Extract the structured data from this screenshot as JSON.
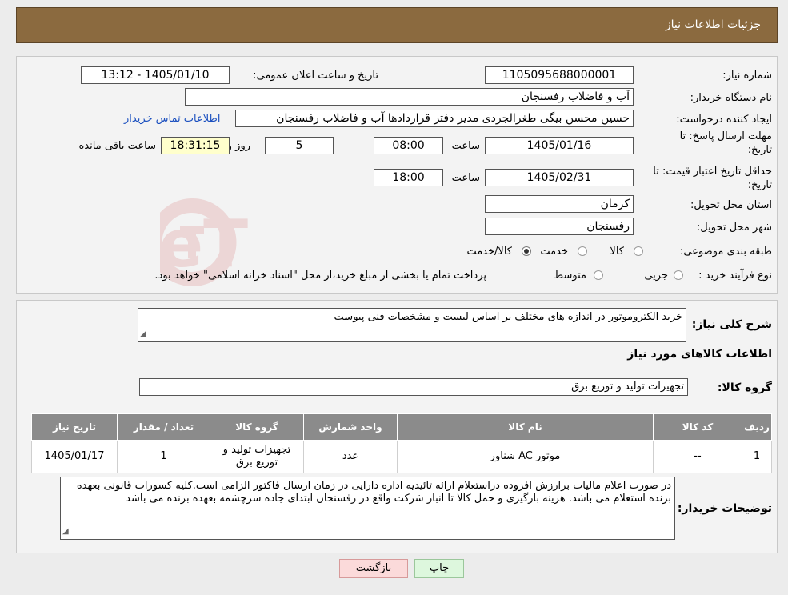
{
  "header": {
    "title": "جزئيات اطلاعات نیاز"
  },
  "form": {
    "need_number_label": "شماره نیاز:",
    "need_number": "1105095688000001",
    "announce_label": "تاریخ و ساعت اعلان عمومی:",
    "announce_value": "1405/01/10 - 13:12",
    "buyer_org_label": "نام دستگاه خریدار:",
    "buyer_org": "آب و فاضلاب رفسنجان",
    "creator_label": "ایجاد کننده درخواست:",
    "creator": "حسین محسن بیگی طغرالجردی مدیر دفتر قراردادها آب و فاضلاب رفسنجان",
    "contact_link": "اطلاعات تماس خریدار",
    "deadline_label_1": "مهلت ارسال پاسخ: تا",
    "deadline_label_2": "تاریخ:",
    "deadline_date": "1405/01/16",
    "time_label": "ساعت",
    "deadline_time": "08:00",
    "days_value": "5",
    "days_label": "روز و",
    "remaining_time": "18:31:15",
    "remaining_label": "ساعت باقی مانده",
    "validity_label_1": "حداقل تاریخ اعتبار قیمت: تا",
    "validity_label_2": "تاریخ:",
    "validity_date": "1405/02/31",
    "validity_time_label": "ساعت",
    "validity_time": "18:00",
    "province_label": "استان محل تحویل:",
    "province": "کرمان",
    "city_label": "شهر محل تحویل:",
    "city": "رفسنجان",
    "category_label": "طبقه بندی موضوعی:",
    "category_options": [
      "کالا",
      "خدمت",
      "کالا/خدمت"
    ],
    "category_selected": "کالا/خدمت",
    "process_label": "نوع فرآیند خرید :",
    "process_options": [
      "جزیی",
      "متوسط"
    ],
    "process_note": "پرداخت تمام یا بخشی از مبلغ خرید،از محل \"اسناد خزانه اسلامی\" خواهد بود."
  },
  "summary": {
    "desc_label": "شرح کلی نیاز:",
    "desc_value": "خرید الکتروموتور در اندازه های مختلف بر اساس لیست و مشخصات فنی پیوست",
    "goods_info_title": "اطلاعات کالاهای مورد نیاز",
    "goods_group_label": "گروه کالا:",
    "goods_group_value": "تجهیزات تولید و توزیع برق"
  },
  "table": {
    "headers": [
      "ردیف",
      "کد کالا",
      "نام کالا",
      "واحد شمارش",
      "گروه کالا",
      "تعداد / مقدار",
      "تاریخ نیاز"
    ],
    "rows": [
      {
        "row": "1",
        "code": "--",
        "name": "موتور AC شناور",
        "unit": "عدد",
        "group": "تجهیزات تولید و توزیع برق",
        "qty": "1",
        "date": "1405/01/17"
      }
    ]
  },
  "buyer_notes": {
    "label": "توضیحات خریدار:",
    "text": "در صورت اعلام مالیات برارزش افزوده دراستعلام ارائه تائیدیه اداره دارایی در زمان ارسال فاکتور الزامی است.کلیه کسورات قانونی بعهده برنده استعلام می باشد. هزینه بارگیری و حمل کالا تا انبار شرکت واقع در رفسنجان ابتدای جاده سرچشمه بعهده برنده می باشد"
  },
  "buttons": {
    "print": "چاپ",
    "back": "بازگشت"
  },
  "colors": {
    "header_bg": "#8b6a3f",
    "table_header_bg": "#8b8b8b",
    "print_btn_bg": "#ddf7dd",
    "back_btn_bg": "#fbdada",
    "link": "#1a4fbf"
  }
}
